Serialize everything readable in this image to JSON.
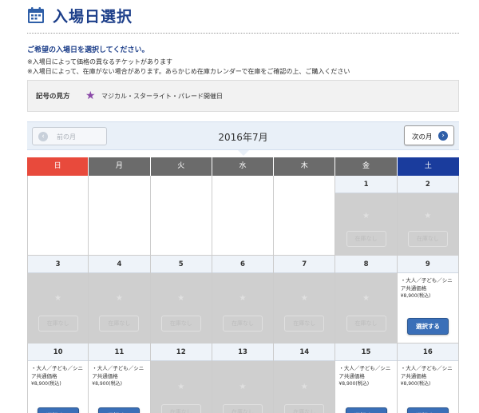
{
  "page": {
    "title": "入場日選択"
  },
  "notes": {
    "lead": "ご希望の入場日を選択してください。",
    "line1": "※入場日によって価格の異なるチケットがあります",
    "line2": "※入場日によって、在庫がない場合があります。あらかじめ在庫カレンダーで在庫をご確認の上、ご購入ください"
  },
  "legend": {
    "label": "記号の見方",
    "item": "マジカル・スターライト・パレード開催日"
  },
  "monthbar": {
    "prev": "前の月",
    "month": "2016年7月",
    "next": "次の月"
  },
  "weekdays": [
    "日",
    "月",
    "火",
    "水",
    "木",
    "金",
    "土"
  ],
  "labels": {
    "unavailable": "在庫なし",
    "select": "選択する",
    "price_line1": "・大人／子ども／シニ",
    "price_line2": "ア共通価格",
    "price_amount": "¥8,900(税込)"
  },
  "weeks": [
    [
      {
        "day": "",
        "state": "empty"
      },
      {
        "day": "",
        "state": "empty"
      },
      {
        "day": "",
        "state": "empty"
      },
      {
        "day": "",
        "state": "empty"
      },
      {
        "day": "",
        "state": "empty"
      },
      {
        "day": "1",
        "state": "na"
      },
      {
        "day": "2",
        "state": "na"
      }
    ],
    [
      {
        "day": "3",
        "state": "na"
      },
      {
        "day": "4",
        "state": "na"
      },
      {
        "day": "5",
        "state": "na"
      },
      {
        "day": "6",
        "state": "na"
      },
      {
        "day": "7",
        "state": "na"
      },
      {
        "day": "8",
        "state": "na"
      },
      {
        "day": "9",
        "state": "avail"
      }
    ],
    [
      {
        "day": "10",
        "state": "avail"
      },
      {
        "day": "11",
        "state": "avail"
      },
      {
        "day": "12",
        "state": "na"
      },
      {
        "day": "13",
        "state": "na"
      },
      {
        "day": "14",
        "state": "na"
      },
      {
        "day": "15",
        "state": "avail"
      },
      {
        "day": "16",
        "state": "avail"
      }
    ]
  ],
  "colors": {
    "accent": "#1d3f8a",
    "sunday": "#e84a3c",
    "saturday": "#1a3c9d",
    "weekday": "#6b6b6b",
    "select_button": "#3a6fb8",
    "unavailable_bg": "#cfcfcf",
    "legend_star": "#8a49a8"
  },
  "icons": {
    "header": "calendar-icon",
    "legend": "star-icon",
    "prev": "chevron-left-icon",
    "next": "chevron-right-icon"
  }
}
